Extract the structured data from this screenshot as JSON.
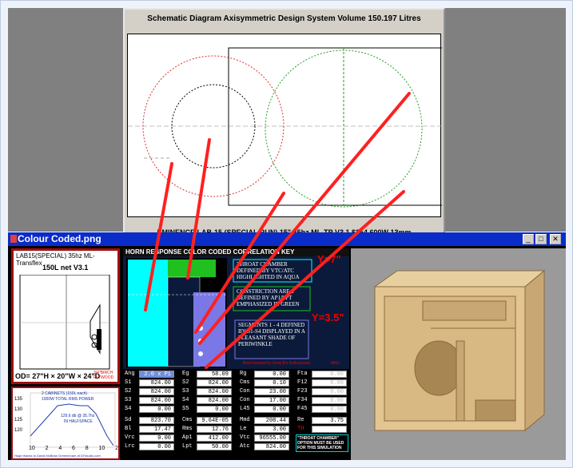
{
  "schematic": {
    "title": "Schematic Diagram   Axisymmetric Design   System Volume 150.197 Litres",
    "footer": "EMINENCE LAB-15 (SPECIAL RUN) 15\" 35hz ML-TP V3.1 $354 600W 13mm"
  },
  "window": {
    "title": "Colour Coded.png",
    "min": "_",
    "max": "□",
    "close": "✕"
  },
  "cabinet": {
    "heading": "LAB15(SPECIAL) 35hz ML-Transflex",
    "subheading": "150L net V3.1",
    "od": "OD= 27\"H × 20\"W × 24\"D",
    "material": "3/4\"BIRCH PLYWOOD"
  },
  "graph": {
    "y_ticks": [
      "135",
      "130",
      "125",
      "120"
    ],
    "x_ticks": [
      "10",
      "2",
      "4",
      "6",
      "8",
      "10",
      "2"
    ],
    "note1": "2 CABINETS (150L each)",
    "note2": "1000W TOTAL RMS POWER",
    "note3": "129.6 db @ 35.7hz",
    "note4": "IN HALFSPACE",
    "credit": "Huge thanks to David McBean Greenercam at DIYaudio.com"
  },
  "key": {
    "heading": "HORN RESPONSE COLOR CODED CORRELATION KEY",
    "y7": "Y=7\"",
    "y35": "Y=3.5\"",
    "box1": "THROAT CHAMBER DEFINED BY VTC/ATC HIGHLIGHTED IN AQUA",
    "box2": "CONSTRICTION AREA DEFINED BY AP1/LPT EMPHASIZED IN GREEN",
    "box3": "SEGMENTS 1 - 4 DEFINED BY S1-S4 DISPLAYED IN A PLEASANT SHADE OF PERIWINKLE",
    "credit": "Bold inspired by Greg B's Enthusiastic",
    "mmj": "MMJ"
  },
  "table": {
    "rows": [
      [
        [
          "Ang",
          "2.0 x Pi"
        ],
        [
          "Eg",
          "58.09"
        ],
        [
          "Rg",
          "0.00"
        ],
        [
          "Fta",
          "0.00"
        ]
      ],
      [
        [
          "S1",
          "824.00"
        ],
        [
          "S2",
          "824.00"
        ],
        [
          "Cms",
          "0.10"
        ],
        [
          "F12",
          "0.00"
        ]
      ],
      [
        [
          "S2",
          "824.00"
        ],
        [
          "S3",
          "824.00"
        ],
        [
          "Con",
          "23.00"
        ],
        [
          "F23",
          "0.00"
        ]
      ],
      [
        [
          "S3",
          "824.00"
        ],
        [
          "S4",
          "824.00"
        ],
        [
          "Con",
          "17.00"
        ],
        [
          "F34",
          "0.00"
        ]
      ],
      [
        [
          "S4",
          "0.00"
        ],
        [
          "S5",
          "0.00"
        ],
        [
          "L45",
          "0.00"
        ],
        [
          "F45",
          "0.00"
        ]
      ]
    ],
    "rows2": [
      [
        [
          "Sd",
          "823.70"
        ],
        [
          "Cms",
          "9.64E-05"
        ],
        [
          "Mmd",
          "208.44"
        ],
        [
          "Re",
          "3.75"
        ]
      ],
      [
        [
          "Bl",
          "17.47"
        ],
        [
          "Rms",
          "12.76"
        ],
        [
          "Le",
          "3.00"
        ],
        [
          "TH",
          ""
        ]
      ],
      [
        [
          "Vrc",
          "0.00"
        ],
        [
          "Ap1",
          "412.00"
        ],
        [
          "Vtc",
          "96555.00"
        ]
      ],
      [
        [
          "Lrc",
          "0.00"
        ],
        [
          "Lpt",
          "50.00"
        ],
        [
          "Atc",
          "824.00"
        ]
      ]
    ],
    "option": "\"THROAT CHAMBER\" OPTION MUST BE USED FOR THIS SIMULATION"
  }
}
